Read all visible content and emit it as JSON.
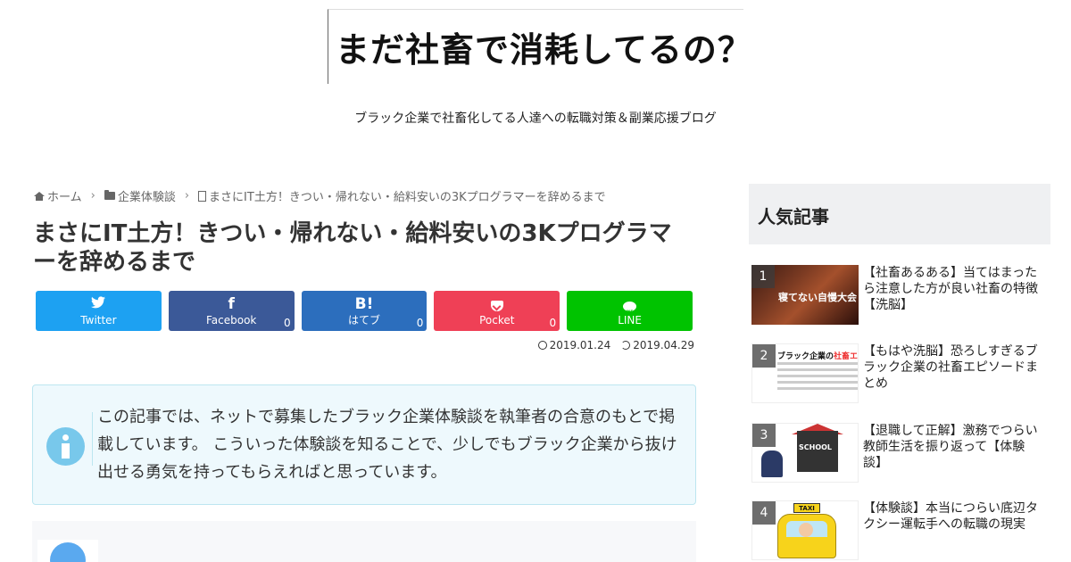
{
  "header": {
    "logo_text": "まだ社畜で消耗してるの？",
    "tagline": "ブラック企業で社畜化してる人達への転職対策＆副業応援ブログ"
  },
  "breadcrumb": {
    "home": "ホーム",
    "category": "企業体験談",
    "current": "まさにIT土方！きつい・帰れない・給料安いの3Kプログラマーを辞めるまで"
  },
  "article": {
    "title": "まさにIT土方！きつい・帰れない・給料安いの3Kプログラマーを辞めるまで",
    "published": "2019.01.24",
    "updated": "2019.04.29",
    "info_text": "この記事では、ネットで募集したブラック企業体験談を執筆者の合意のもとで掲載しています。 こういった体験談を知ることで、少しでもブラック企業から抜け出せる勇気を持ってもらえればと思っています。"
  },
  "share": [
    {
      "icon": "twitter-icon",
      "icon_char": "🐦",
      "label": "Twitter",
      "count": "",
      "color": "#1da1f2"
    },
    {
      "icon": "facebook-icon",
      "icon_char": "f",
      "label": "Facebook",
      "count": "0",
      "color": "#3b5998"
    },
    {
      "icon": "hatebu-icon",
      "icon_char": "B!",
      "label": "はてブ",
      "count": "0",
      "color": "#2c6ebd"
    },
    {
      "icon": "pocket-icon",
      "icon_char": "",
      "label": "Pocket",
      "count": "0",
      "color": "#ef4056"
    },
    {
      "icon": "line-icon",
      "icon_char": "",
      "label": "LINE",
      "count": "",
      "color": "#00c300"
    }
  ],
  "sidebar": {
    "title": "人気記事",
    "items": [
      {
        "rank": "1",
        "title": "【社畜あるある】当てはまったら注意した方が良い社畜の特徴【洗脳】",
        "thumb_caption": "寝てない自慢大会"
      },
      {
        "rank": "2",
        "title": "【もはや洗脳】恐ろしすぎるブラック企業の社畜エピソードまとめ",
        "thumb_caption_a": "ブラック企業の",
        "thumb_caption_b": "社畜エピソード"
      },
      {
        "rank": "3",
        "title": "【退職して正解】激務でつらい教師生活を振り返って【体験談】",
        "thumb_caption": "SCHOOL"
      },
      {
        "rank": "4",
        "title": "【体験談】本当につらい底辺タクシー運転手への転職の現実",
        "thumb_caption": "TAXI"
      }
    ]
  }
}
